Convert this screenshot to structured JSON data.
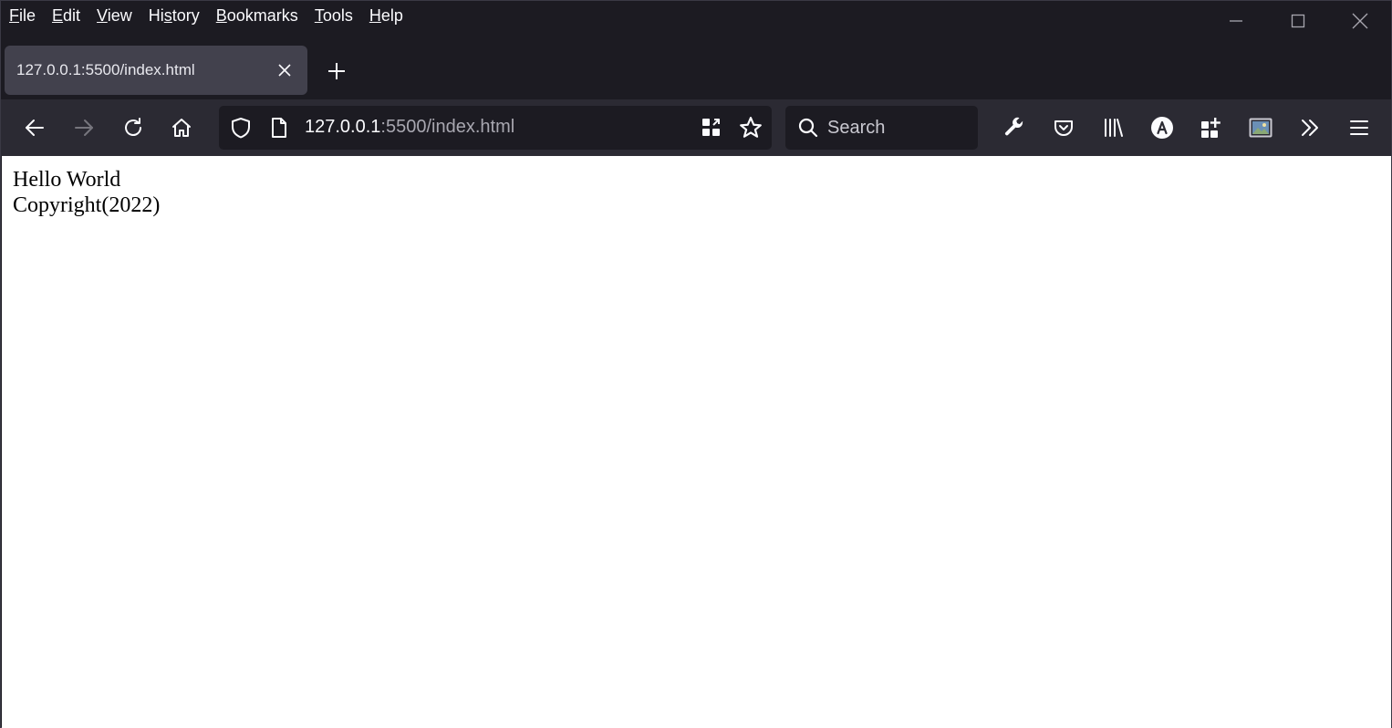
{
  "menu": {
    "items": [
      {
        "label_ul": "F",
        "label_rest": "ile"
      },
      {
        "label_ul": "E",
        "label_rest": "dit"
      },
      {
        "label_ul": "V",
        "label_rest": "iew"
      },
      {
        "label_pre": "Hi",
        "label_ul": "s",
        "label_rest": "tory"
      },
      {
        "label_ul": "B",
        "label_rest": "ookmarks"
      },
      {
        "label_ul": "T",
        "label_rest": "ools"
      },
      {
        "label_ul": "H",
        "label_rest": "elp"
      }
    ]
  },
  "tab": {
    "title": "127.0.0.1:5500/index.html"
  },
  "urlbar": {
    "host": "127.0.0.1",
    "path": ":5500/index.html"
  },
  "search": {
    "placeholder": "Search"
  },
  "page": {
    "line1": "Hello World",
    "line2": "Copyright(2022)"
  },
  "colors": {
    "chrome_bg": "#1c1b22",
    "toolbar_bg": "#2b2a33",
    "tab_selected_bg": "#42414d",
    "text": "#fbfbfe"
  },
  "icons": [
    "back-icon",
    "forward-icon",
    "reload-icon",
    "home-icon",
    "shield-icon",
    "page-icon",
    "qr-code-icon",
    "star-icon",
    "search-icon",
    "wrench-icon",
    "pocket-icon",
    "library-icon",
    "account-icon",
    "extensions-icon",
    "screenshot-icon",
    "overflow-icon",
    "hamburger-menu-icon"
  ]
}
